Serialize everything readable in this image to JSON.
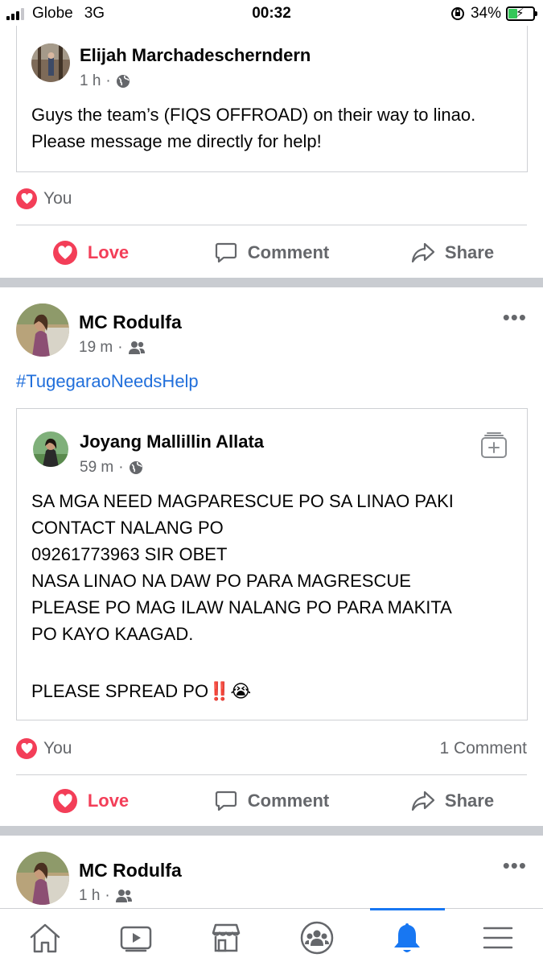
{
  "status_bar": {
    "carrier": "Globe",
    "network": "3G",
    "time": "00:32",
    "battery": "34%"
  },
  "post1": {
    "author": "Elijah Marchadescherndern",
    "time": "1 h",
    "text": "Guys the team’s (FIQS OFFROAD) on their way to linao. Please message me directly for help!",
    "reaction_you": "You",
    "actions": {
      "love": "Love",
      "comment": "Comment",
      "share": "Share"
    }
  },
  "post2": {
    "author": "MC Rodulfa",
    "time": "19 m",
    "hashtag": "#TugegaraoNeedsHelp",
    "shared": {
      "author": "Joyang Mallillin Allata",
      "time": "59 m",
      "lines": [
        "SA MGA NEED MAGPARESCUE PO SA LINAO PAKI",
        "CONTACT NALANG PO",
        "09261773963 SIR OBET",
        "NASA LINAO NA DAW PO PARA MAGRESCUE",
        "PLEASE PO MAG ILAW NALANG PO PARA MAKITA",
        "PO KAYO KAAGAD.",
        "PLEASE SPREAD PO‼️😭"
      ]
    },
    "reaction_you": "You",
    "comment_count": "1 Comment",
    "actions": {
      "love": "Love",
      "comment": "Comment",
      "share": "Share"
    }
  },
  "post3": {
    "author": "MC Rodulfa",
    "time": "1 h"
  },
  "colors": {
    "love": "#f33e58",
    "link": "#216fdb",
    "active_tab": "#1877f2",
    "secondary_text": "#65676b"
  },
  "icons": {
    "tabs": [
      "home-icon",
      "video-icon",
      "marketplace-icon",
      "groups-icon",
      "notifications-icon",
      "menu-icon"
    ]
  }
}
